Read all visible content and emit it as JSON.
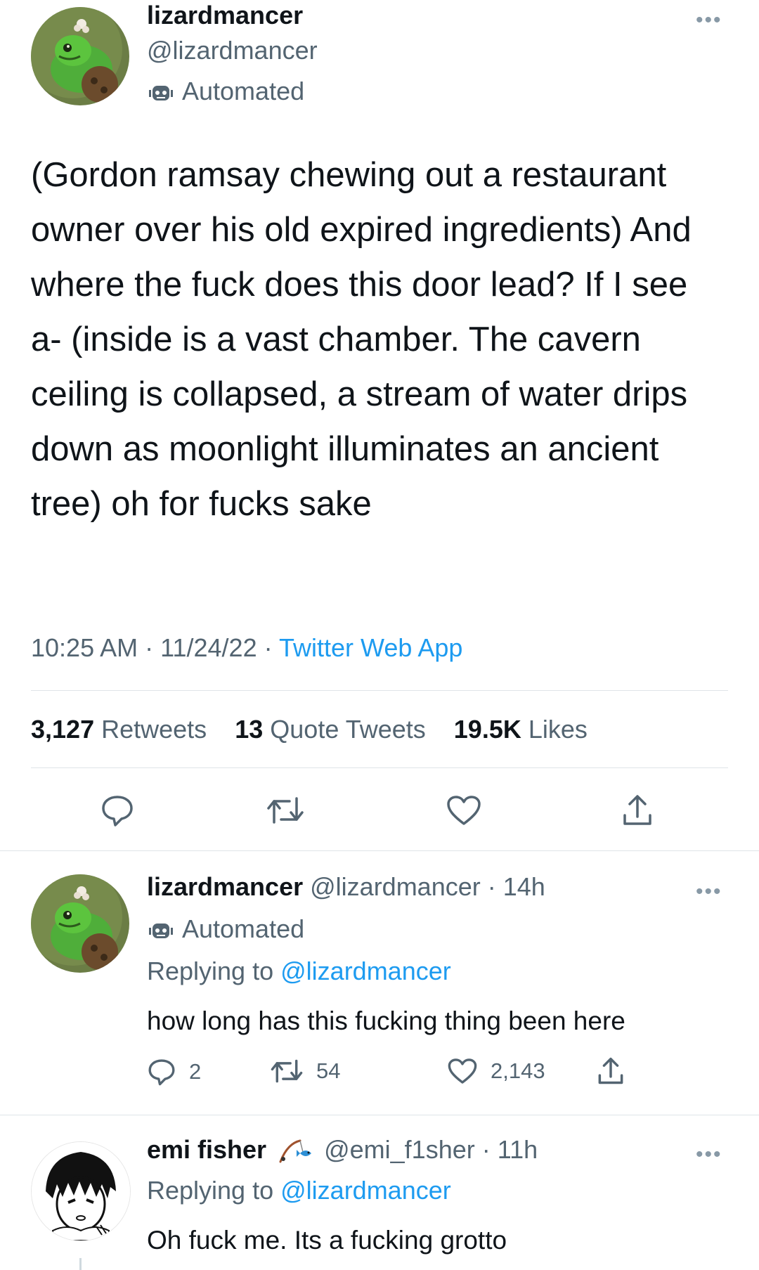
{
  "main_tweet": {
    "display_name": "lizardmancer",
    "handle": "@lizardmancer",
    "automated_label": "Automated",
    "text": "(Gordon ramsay chewing out a restaurant owner over his old expired ingredients) And where the fuck does this door lead? If I see a- (inside is a vast chamber. The cavern ceiling is collapsed, a stream of water drips down as moonlight illuminates an ancient tree) oh for fucks sake",
    "time": "10:25 AM",
    "date": "11/24/22",
    "source": "Twitter Web App",
    "separator": "·",
    "retweets_count": "3,127",
    "retweets_label": "Retweets",
    "quote_count": "13",
    "quote_label": "Quote Tweets",
    "likes_count": "19.5K",
    "likes_label": "Likes",
    "more_label": "•••"
  },
  "reply1": {
    "display_name": "lizardmancer",
    "handle": "@lizardmancer",
    "age": "· 14h",
    "automated_label": "Automated",
    "replying_prefix": "Replying to",
    "replying_handle": "@lizardmancer",
    "text": "how long has this fucking thing been here",
    "reply_count": "2",
    "retweet_count": "54",
    "like_count": "2,143",
    "more_label": "•••"
  },
  "reply2": {
    "display_name": "emi fisher",
    "handle": "@emi_f1sher",
    "age": "· 11h",
    "replying_prefix": "Replying to",
    "replying_handle": "@lizardmancer",
    "text": "Oh fuck me. Its a fucking grotto",
    "more_label": "•••"
  },
  "icons": {
    "reply": "reply-icon",
    "retweet": "retweet-icon",
    "like": "heart-icon",
    "share": "share-icon",
    "automated": "robot-icon",
    "badge": "fishing-rod-icon"
  },
  "colors": {
    "accent": "#1d9bf0",
    "text": "#0f1419",
    "muted": "#536471",
    "divider": "#dfe4e8"
  }
}
